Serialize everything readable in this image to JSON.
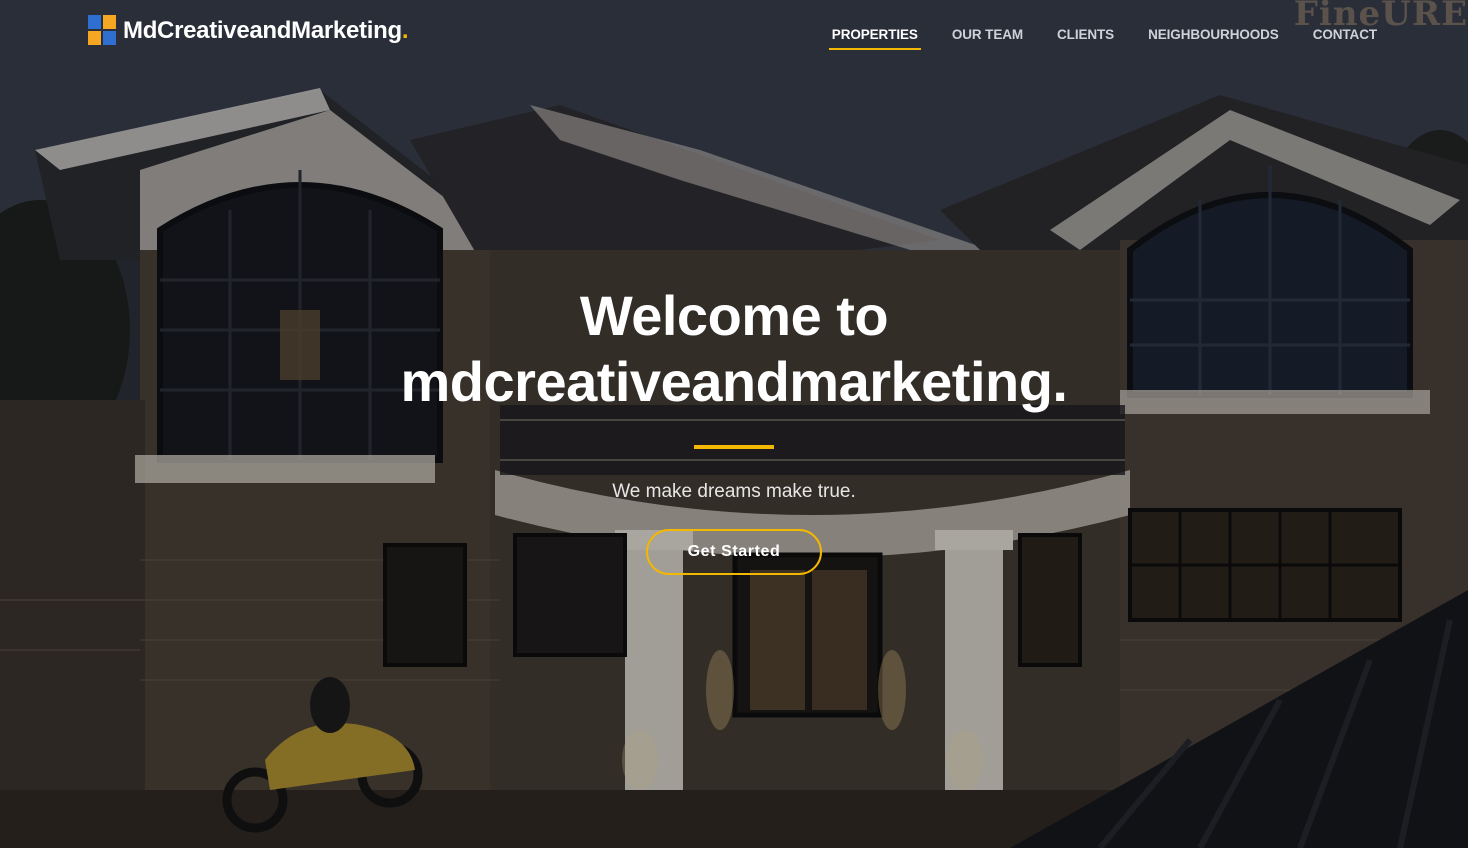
{
  "brand": {
    "name": "MdCreativeandMarketing",
    "dot": ".",
    "logo_icon": "mb-squares-logo-icon",
    "logo_colors": [
      "#f5a623",
      "#2f6fd1"
    ]
  },
  "nav": {
    "items": [
      {
        "label": "PROPERTIES",
        "active": true
      },
      {
        "label": "OUR TEAM",
        "active": false
      },
      {
        "label": "CLIENTS",
        "active": false
      },
      {
        "label": "NEIGHBOURHOODS",
        "active": false
      },
      {
        "label": "CONTACT",
        "active": false
      }
    ]
  },
  "watermark": "FineURE",
  "hero": {
    "title_line1": "Welcome to",
    "title_line2": "mdcreativeandmarketing.",
    "subtitle": "We make dreams make true.",
    "cta_label": "Get Started"
  },
  "colors": {
    "accent": "#f5b800",
    "text": "#ffffff"
  }
}
